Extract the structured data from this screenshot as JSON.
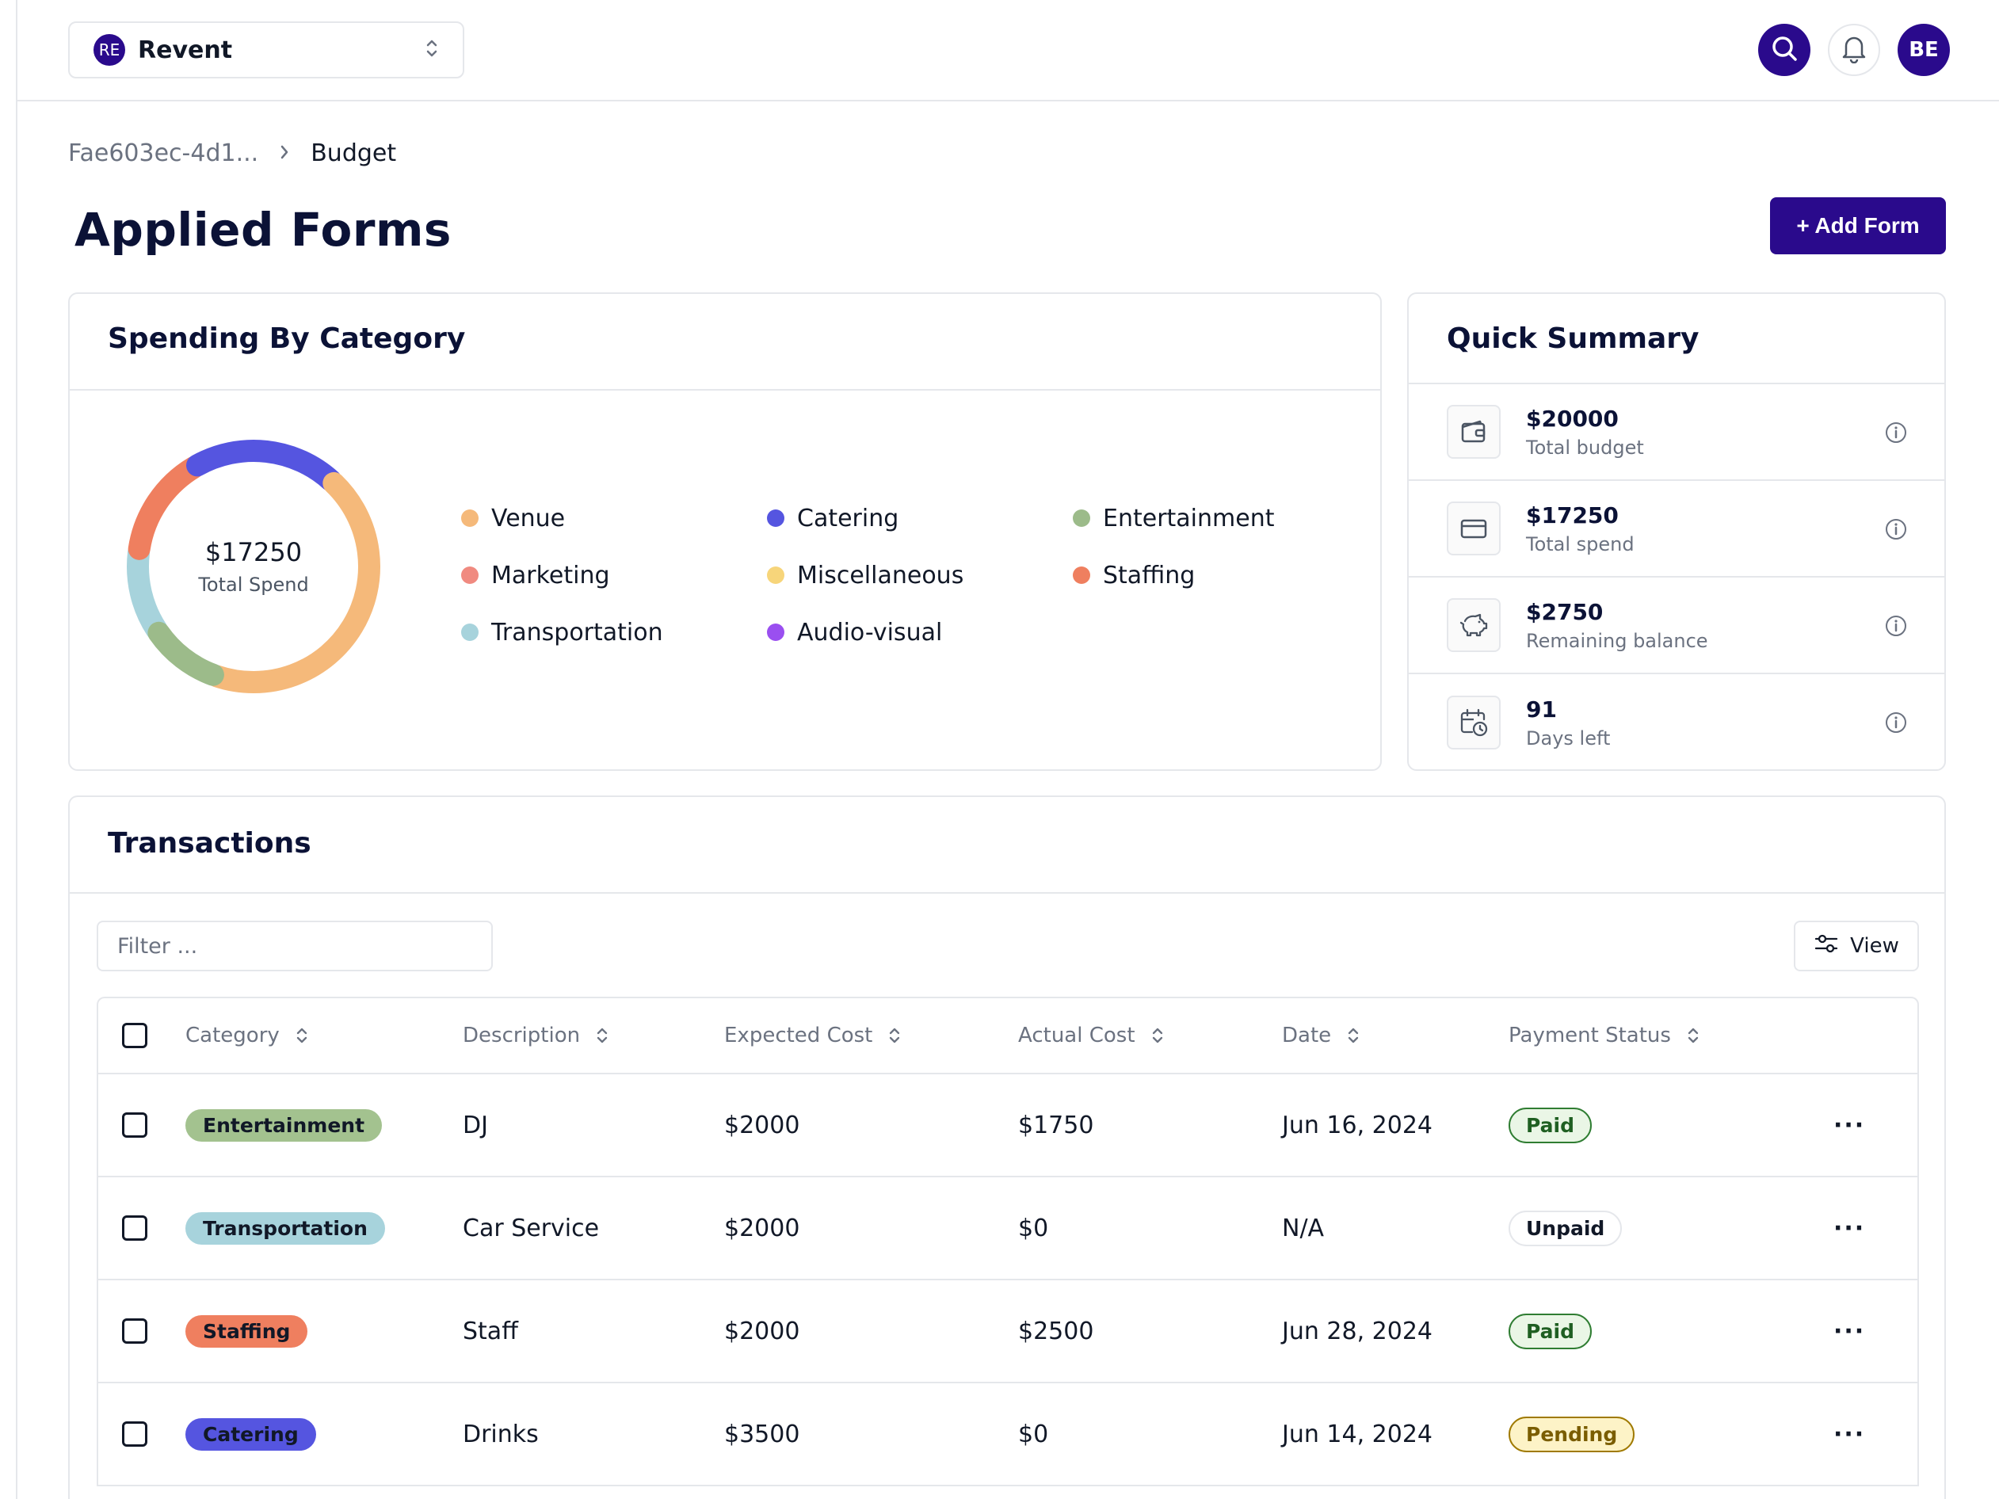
{
  "workspace": {
    "initials": "RE",
    "name": "Revent"
  },
  "user": {
    "initials": "BE"
  },
  "breadcrumb": {
    "parent": "Fae603ec-4d1...",
    "separator": ">",
    "current": "Budget"
  },
  "page": {
    "title": "Applied Forms",
    "add_button": "+ Add Form"
  },
  "spending": {
    "title": "Spending By Category",
    "total_value": "$17250",
    "total_label": "Total Spend",
    "legend": [
      {
        "label": "Venue",
        "color": "#f5b97a"
      },
      {
        "label": "Catering",
        "color": "#5555e0"
      },
      {
        "label": "Entertainment",
        "color": "#9cbb8a"
      },
      {
        "label": "Marketing",
        "color": "#f08a80"
      },
      {
        "label": "Miscellaneous",
        "color": "#f7d57a"
      },
      {
        "label": "Staffing",
        "color": "#ef7f5f"
      },
      {
        "label": "Transportation",
        "color": "#a7d3dc"
      },
      {
        "label": "Audio-visual",
        "color": "#9a4ff0"
      }
    ]
  },
  "chart_data": {
    "type": "pie",
    "variant": "donut",
    "start_angle_deg": -124,
    "slices": [
      {
        "label": "Transportation",
        "value": 2000,
        "color": "#a7d3dc"
      },
      {
        "label": "Staffing",
        "value": 2500,
        "color": "#ef7f5f"
      },
      {
        "label": "Catering",
        "value": 3500,
        "color": "#5555e0"
      },
      {
        "label": "Venue",
        "value": 7500,
        "color": "#f5b97a"
      },
      {
        "label": "Entertainment",
        "value": 1750,
        "color": "#9cbb8a"
      }
    ]
  },
  "summary": {
    "title": "Quick Summary",
    "items": [
      {
        "value": "$20000",
        "label": "Total budget",
        "icon": "wallet-icon"
      },
      {
        "value": "$17250",
        "label": "Total spend",
        "icon": "credit-card-icon"
      },
      {
        "value": "$2750",
        "label": "Remaining balance",
        "icon": "piggy-bank-icon"
      },
      {
        "value": "91",
        "label": "Days left",
        "icon": "calendar-clock-icon"
      }
    ]
  },
  "transactions": {
    "title": "Transactions",
    "filter_placeholder": "Filter ...",
    "view_label": "View",
    "columns": [
      "Category",
      "Description",
      "Expected Cost",
      "Actual Cost",
      "Date",
      "Payment Status"
    ],
    "rows": [
      {
        "category": "Entertainment",
        "description": "DJ",
        "expected": "$2000",
        "actual": "$1750",
        "date": "Jun 16, 2024",
        "status": "Paid"
      },
      {
        "category": "Transportation",
        "description": "Car Service",
        "expected": "$2000",
        "actual": "$0",
        "date": "N/A",
        "status": "Unpaid"
      },
      {
        "category": "Staffing",
        "description": "Staff",
        "expected": "$2000",
        "actual": "$2500",
        "date": "Jun 28, 2024",
        "status": "Paid"
      },
      {
        "category": "Catering",
        "description": "Drinks",
        "expected": "$3500",
        "actual": "$0",
        "date": "Jun 14, 2024",
        "status": "Pending"
      }
    ],
    "more_label": "···"
  },
  "colors": {
    "brand": "#2a0a8c",
    "category": {
      "Entertainment": "#a3c28f",
      "Transportation": "#a7d3dc",
      "Staffing": "#ef7f5f",
      "Catering": "#5555e0"
    },
    "status": {
      "Paid": {
        "bg": "#eaf6e6",
        "border": "#2f7d32",
        "text": "#1f5f22"
      },
      "Unpaid": {
        "bg": "#ffffff",
        "border": "#e5e7eb",
        "text": "#111827"
      },
      "Pending": {
        "bg": "#fdf3c7",
        "border": "#a07a00",
        "text": "#7a5d00"
      }
    }
  }
}
